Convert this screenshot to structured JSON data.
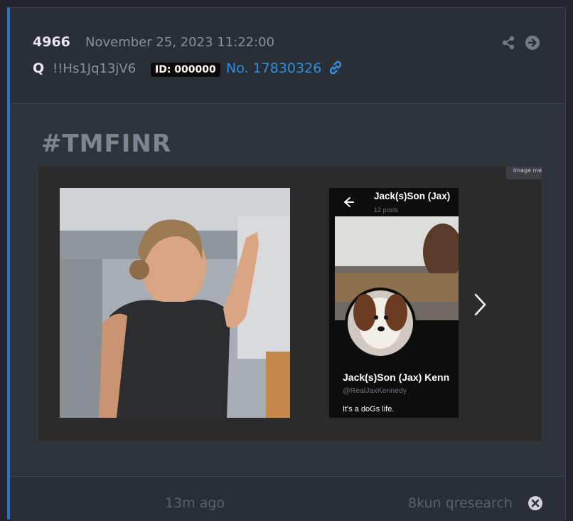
{
  "post": {
    "number": "4966",
    "timestamp": "November 25, 2023 11:22:00",
    "author": "Q",
    "tripcode": "!!Hs1Jq13jV6",
    "id_badge": "ID: 000000",
    "post_no": "No. 17830326"
  },
  "content": {
    "hashtag": "#TMFINR"
  },
  "gallery": {
    "image_meta_label": "Image me",
    "right_image": {
      "header_name": "Jack(s)Son (Jax)",
      "posts_count": "12 posts",
      "profile_name": "Jack(s)Son (Jax) Kenn",
      "handle": "@RealJaxKennedy",
      "bio": "It's a doGs life."
    }
  },
  "footer": {
    "time_ago": "13m ago",
    "source": "8kun qresearch"
  },
  "icons": {
    "share": "share-icon",
    "goto": "arrow-right-circle-icon",
    "link": "link-icon",
    "next": "chevron-right-icon",
    "close": "close-circle-icon"
  },
  "colors": {
    "accent": "#2e6fd0",
    "link": "#2f8fe0",
    "background": "#22252b"
  }
}
